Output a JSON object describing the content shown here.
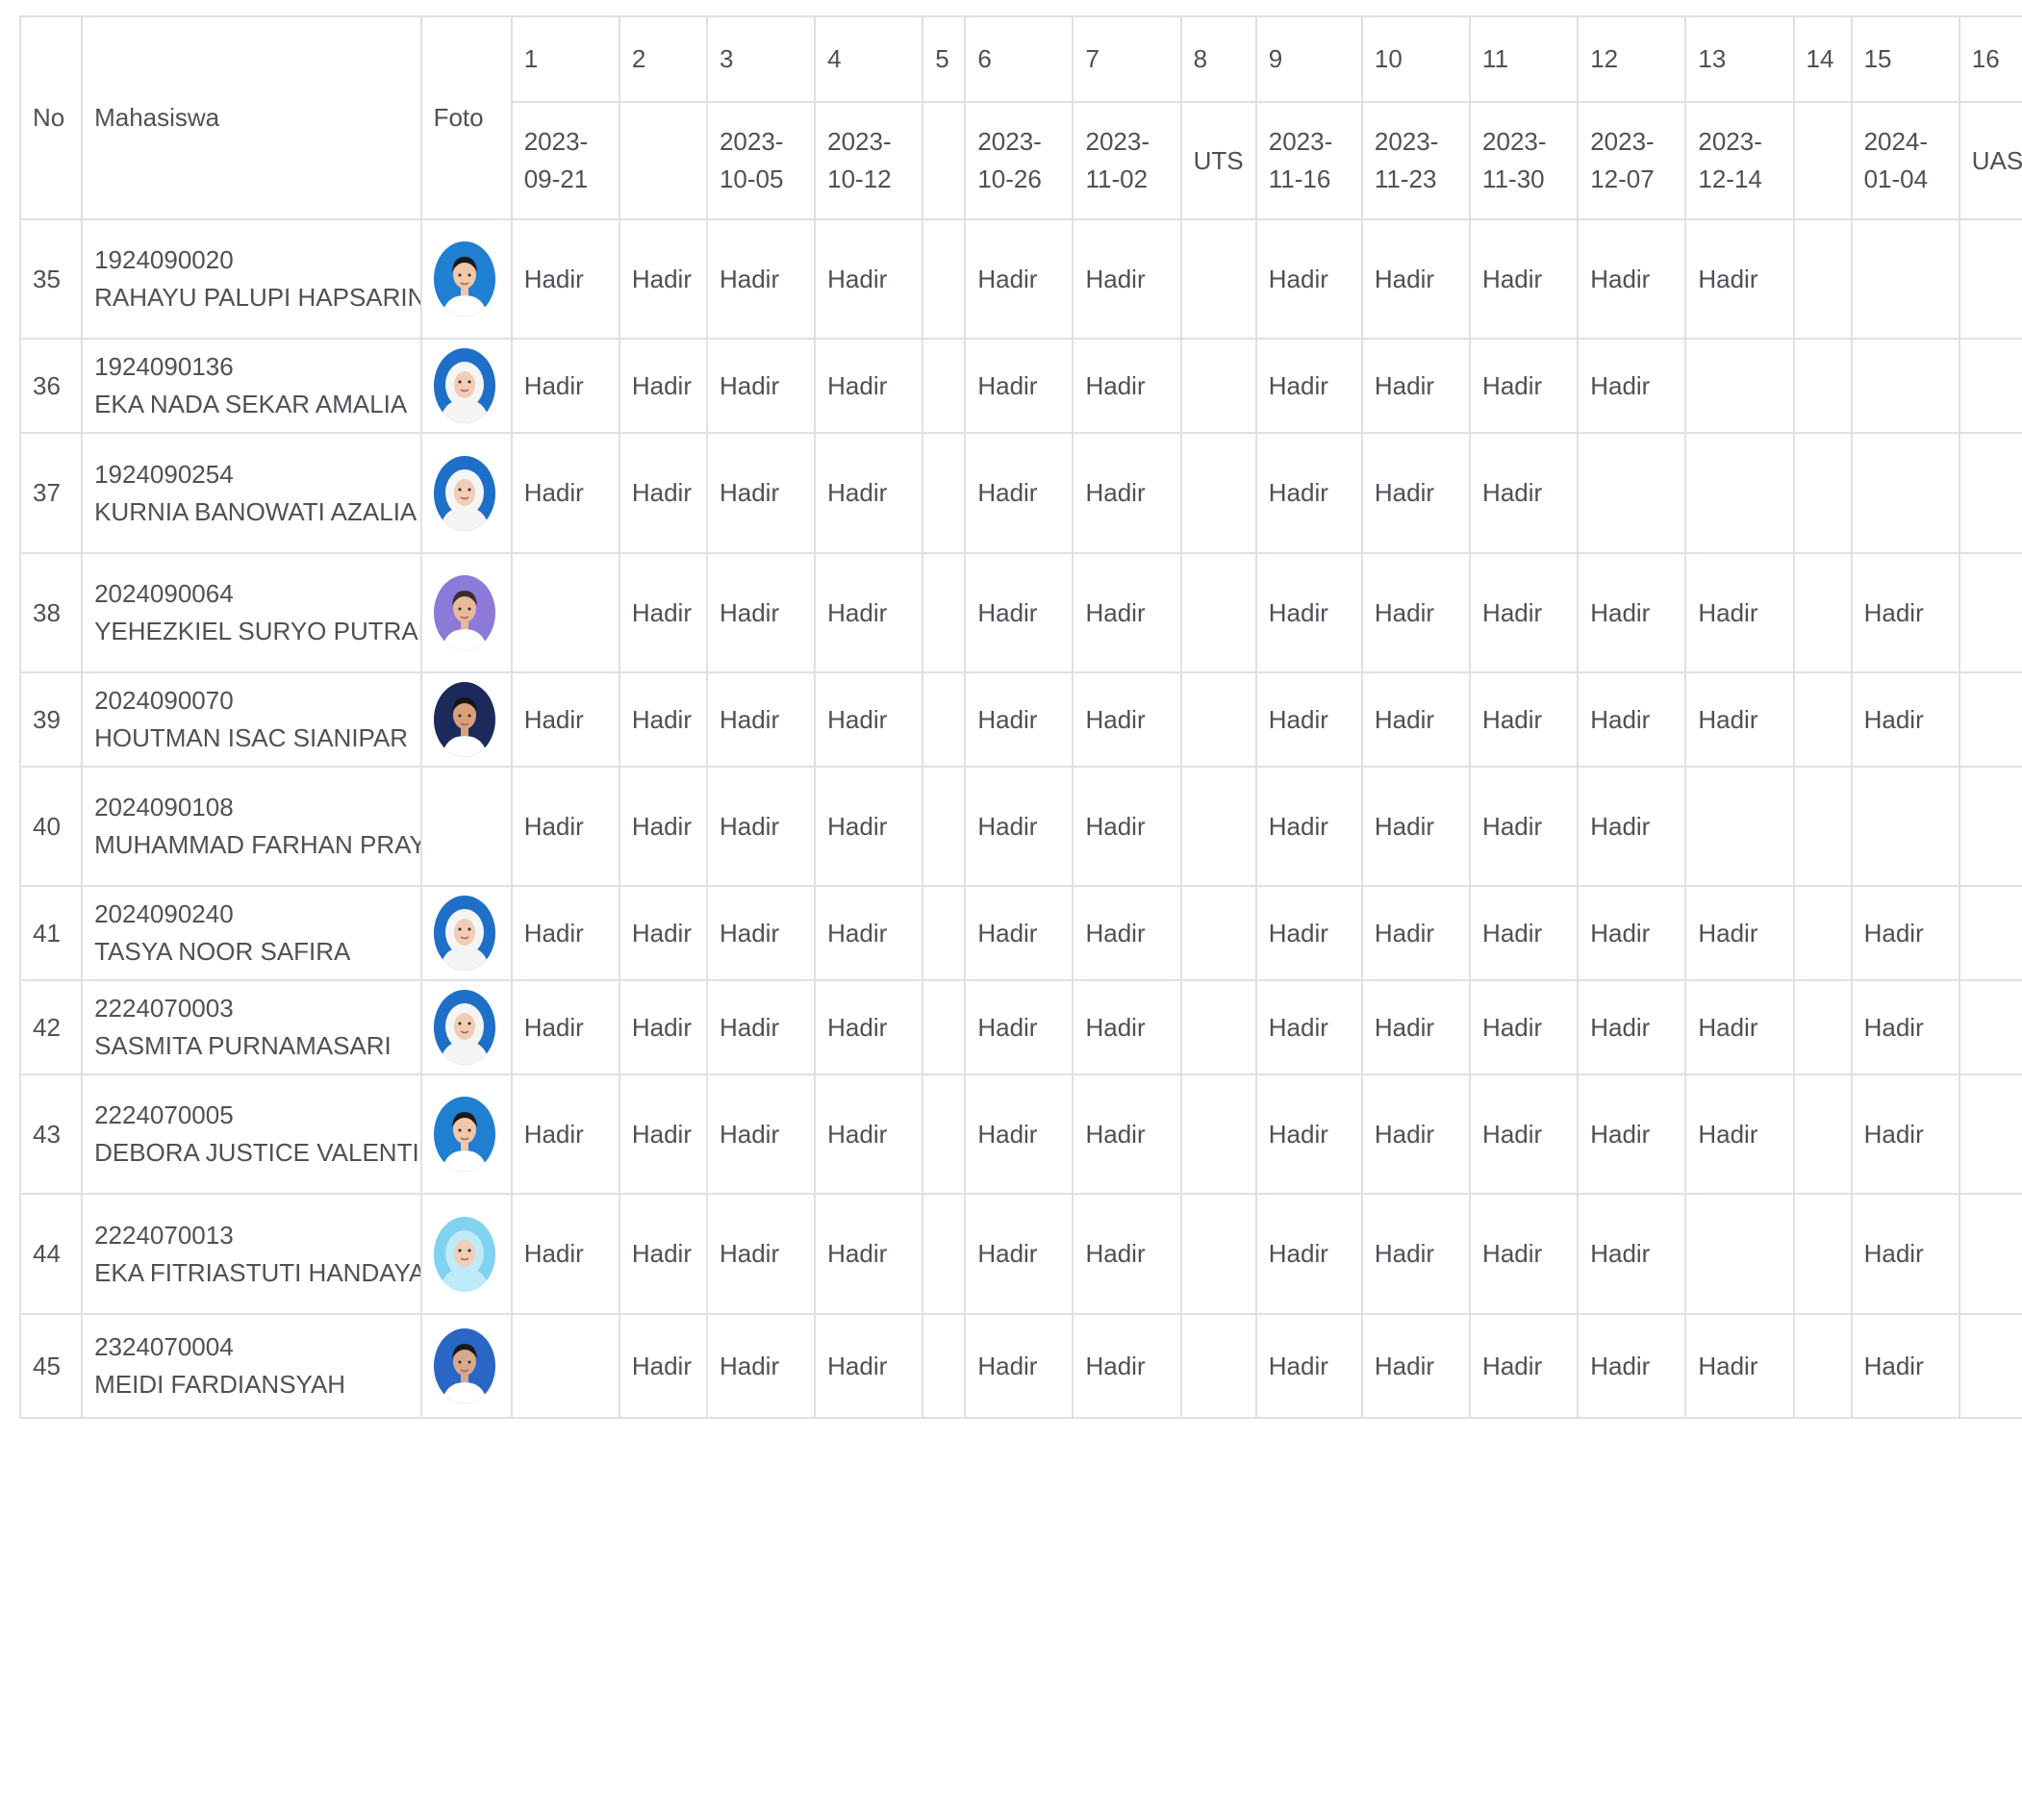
{
  "table": {
    "col_no": "No",
    "col_student": "Mahasiswa",
    "col_photo": "Foto",
    "meetings": [
      {
        "num": "1",
        "date_line1": "2023-",
        "date_line2": "09-21",
        "label": ""
      },
      {
        "num": "2",
        "date_line1": "",
        "date_line2": "",
        "label": ""
      },
      {
        "num": "3",
        "date_line1": "2023-",
        "date_line2": "10-05",
        "label": ""
      },
      {
        "num": "4",
        "date_line1": "2023-",
        "date_line2": "10-12",
        "label": ""
      },
      {
        "num": "5",
        "date_line1": "",
        "date_line2": "",
        "label": ""
      },
      {
        "num": "6",
        "date_line1": "2023-",
        "date_line2": "10-26",
        "label": ""
      },
      {
        "num": "7",
        "date_line1": "2023-",
        "date_line2": "11-02",
        "label": ""
      },
      {
        "num": "8",
        "date_line1": "",
        "date_line2": "",
        "label": "UTS"
      },
      {
        "num": "9",
        "date_line1": "2023-",
        "date_line2": "11-16",
        "label": ""
      },
      {
        "num": "10",
        "date_line1": "2023-",
        "date_line2": "11-23",
        "label": ""
      },
      {
        "num": "11",
        "date_line1": "2023-",
        "date_line2": "11-30",
        "label": ""
      },
      {
        "num": "12",
        "date_line1": "2023-",
        "date_line2": "12-07",
        "label": ""
      },
      {
        "num": "13",
        "date_line1": "2023-",
        "date_line2": "12-14",
        "label": ""
      },
      {
        "num": "14",
        "date_line1": "",
        "date_line2": "",
        "label": ""
      },
      {
        "num": "15",
        "date_line1": "2024-",
        "date_line2": "01-04",
        "label": ""
      },
      {
        "num": "16",
        "date_line1": "",
        "date_line2": "",
        "label": "UAS"
      }
    ],
    "rows": [
      {
        "no": "35",
        "nim": "1924090020",
        "name": "RAHAYU PALUPI HAPSARINI",
        "photo": true,
        "photo_style": "female-dark-hair",
        "attendance": [
          "Hadir",
          "Hadir",
          "Hadir",
          "Hadir",
          "",
          "Hadir",
          "Hadir",
          "",
          "Hadir",
          "Hadir",
          "Hadir",
          "Hadir",
          "Hadir",
          "",
          "",
          ""
        ]
      },
      {
        "no": "36",
        "nim": "1924090136",
        "name": "EKA NADA SEKAR AMALIA",
        "photo": true,
        "photo_style": "female-white-hijab",
        "attendance": [
          "Hadir",
          "Hadir",
          "Hadir",
          "Hadir",
          "",
          "Hadir",
          "Hadir",
          "",
          "Hadir",
          "Hadir",
          "Hadir",
          "Hadir",
          "",
          "",
          "",
          ""
        ]
      },
      {
        "no": "37",
        "nim": "1924090254",
        "name": "KURNIA BANOWATI AZALIA AMANDA",
        "photo": true,
        "photo_style": "female-white-hijab",
        "attendance": [
          "Hadir",
          "Hadir",
          "Hadir",
          "Hadir",
          "",
          "Hadir",
          "Hadir",
          "",
          "Hadir",
          "Hadir",
          "Hadir",
          "",
          "",
          "",
          "",
          ""
        ]
      },
      {
        "no": "38",
        "nim": "2024090064",
        "name": "YEHEZKIEL SURYO PUTRANTO",
        "photo": true,
        "photo_style": "male-purple-bg",
        "attendance": [
          "",
          "Hadir",
          "Hadir",
          "Hadir",
          "",
          "Hadir",
          "Hadir",
          "",
          "Hadir",
          "Hadir",
          "Hadir",
          "Hadir",
          "Hadir",
          "",
          "Hadir",
          ""
        ]
      },
      {
        "no": "39",
        "nim": "2024090070",
        "name": "HOUTMAN ISAC SIANIPAR",
        "photo": true,
        "photo_style": "male-dark-bg",
        "attendance": [
          "Hadir",
          "Hadir",
          "Hadir",
          "Hadir",
          "",
          "Hadir",
          "Hadir",
          "",
          "Hadir",
          "Hadir",
          "Hadir",
          "Hadir",
          "Hadir",
          "",
          "Hadir",
          ""
        ]
      },
      {
        "no": "40",
        "nim": "2024090108",
        "name": "MUHAMMAD FARHAN PRAYOGO",
        "photo": false,
        "photo_style": "",
        "attendance": [
          "Hadir",
          "Hadir",
          "Hadir",
          "Hadir",
          "",
          "Hadir",
          "Hadir",
          "",
          "Hadir",
          "Hadir",
          "Hadir",
          "Hadir",
          "",
          "",
          "",
          ""
        ]
      },
      {
        "no": "41",
        "nim": "2024090240",
        "name": "TASYA NOOR SAFIRA",
        "photo": true,
        "photo_style": "female-white-hijab",
        "attendance": [
          "Hadir",
          "Hadir",
          "Hadir",
          "Hadir",
          "",
          "Hadir",
          "Hadir",
          "",
          "Hadir",
          "Hadir",
          "Hadir",
          "Hadir",
          "Hadir",
          "",
          "Hadir",
          ""
        ]
      },
      {
        "no": "42",
        "nim": "2224070003",
        "name": "SASMITA PURNAMASARI",
        "photo": true,
        "photo_style": "female-white-hijab",
        "attendance": [
          "Hadir",
          "Hadir",
          "Hadir",
          "Hadir",
          "",
          "Hadir",
          "Hadir",
          "",
          "Hadir",
          "Hadir",
          "Hadir",
          "Hadir",
          "Hadir",
          "",
          "Hadir",
          ""
        ]
      },
      {
        "no": "43",
        "nim": "2224070005",
        "name": "DEBORA JUSTICE VALENTINA",
        "photo": true,
        "photo_style": "female-dark-hair",
        "attendance": [
          "Hadir",
          "Hadir",
          "Hadir",
          "Hadir",
          "",
          "Hadir",
          "Hadir",
          "",
          "Hadir",
          "Hadir",
          "Hadir",
          "Hadir",
          "Hadir",
          "",
          "Hadir",
          ""
        ]
      },
      {
        "no": "44",
        "nim": "2224070013",
        "name": "EKA FITRIASTUTI HANDAYANI",
        "photo": true,
        "photo_style": "female-light-blue-hijab",
        "attendance": [
          "Hadir",
          "Hadir",
          "Hadir",
          "Hadir",
          "",
          "Hadir",
          "Hadir",
          "",
          "Hadir",
          "Hadir",
          "Hadir",
          "Hadir",
          "",
          "",
          "Hadir",
          ""
        ]
      },
      {
        "no": "45",
        "nim": "2324070004",
        "name": "MEIDI FARDIANSYAH",
        "photo": true,
        "photo_style": "male-blue-bg",
        "attendance": [
          "",
          "Hadir",
          "Hadir",
          "Hadir",
          "",
          "Hadir",
          "Hadir",
          "",
          "Hadir",
          "Hadir",
          "Hadir",
          "Hadir",
          "Hadir",
          "",
          "Hadir",
          ""
        ]
      }
    ]
  },
  "colors": {
    "border": "#dde1e6",
    "text": "#4d5156",
    "background": "#ffffff"
  }
}
